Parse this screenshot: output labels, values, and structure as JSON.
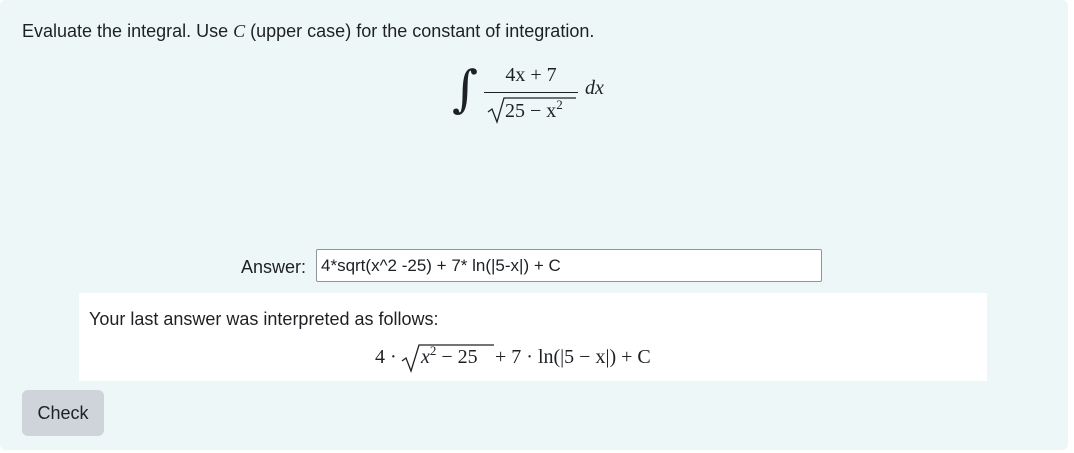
{
  "question": {
    "text_before": "Evaluate the integral. Use ",
    "variable": "C",
    "text_after": " (upper case) for the constant of integration."
  },
  "integral": {
    "sign": "∫",
    "numerator": "4x + 7",
    "radicand_base": "25 − x",
    "radicand_exp": "2",
    "differential": "dx"
  },
  "answer": {
    "label": "Answer:",
    "value": "4*sqrt(x^2 -25) + 7* ln(|5-x|) + C"
  },
  "feedback": {
    "text": "Your last answer was interpreted as follows:",
    "math_prefix": "4 · ",
    "math_radicand_base": "x",
    "math_radicand_exp": "2",
    "math_radicand_rest": " − 25",
    "math_suffix": " + 7 · ln(|5 − x|) + C"
  },
  "check_button": {
    "label": "Check"
  },
  "colors": {
    "panel_background": "#eef7f7",
    "button_background": "#ced4da",
    "text": "#1d2125"
  }
}
